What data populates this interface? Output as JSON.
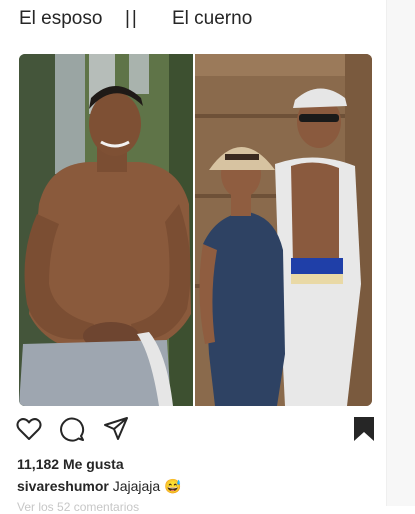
{
  "header_caption": {
    "left": "El esposo",
    "separator": "||",
    "right": "El cuerno"
  },
  "post": {
    "image_left_alt": "Shirtless man in grey shorts outdoors",
    "image_right_alt": "Woman in straw hat and denim jumpsuit with man in white cap and sunglasses"
  },
  "actions": {
    "like_icon": "heart-icon",
    "comment_icon": "comment-icon",
    "share_icon": "paper-plane-icon",
    "save_icon": "bookmark-icon"
  },
  "likes_text": "11,182 Me gusta",
  "caption": {
    "username": "sivareshumor",
    "text": "Jajajaja",
    "emoji": "😅"
  },
  "comments_link": "Ver los 52 comentarios",
  "colors": {
    "text": "#262626",
    "muted": "#c7c7c7",
    "background": "#ffffff"
  }
}
